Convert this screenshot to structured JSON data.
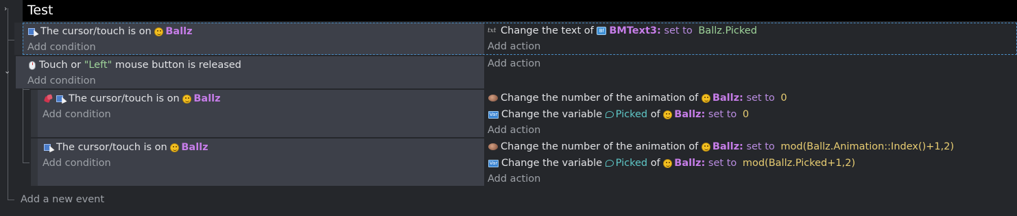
{
  "group": {
    "title": "Test",
    "expand_icon": "chevron-right-icon"
  },
  "events": [
    {
      "conditions": [
        {
          "icons": [
            "cursor-touch-icon"
          ],
          "text": "The cursor/touch is on",
          "object": "Ballz"
        }
      ],
      "add_condition": "Add condition",
      "actions": [
        {
          "icon": "text-icon",
          "text": "Change the text of",
          "object_icon": "bmtext-icon",
          "object": "BMText3",
          "colon": ":",
          "op": "set to",
          "value": "Ballz.Picked"
        }
      ],
      "add_action": "Add action"
    },
    {
      "collapse_icon": "chevron-down-icon",
      "conditions": [
        {
          "icons": [
            "mouse-icon"
          ],
          "prefix": "Touch or",
          "button": "\"Left\"",
          "suffix": "mouse button is released"
        }
      ],
      "add_condition": "Add condition",
      "add_action": "Add action",
      "sub_events": [
        {
          "conditions": [
            {
              "icons": [
                "inverted-condition-icon",
                "cursor-touch-icon"
              ],
              "text": "The cursor/touch is on",
              "object": "Ballz"
            }
          ],
          "add_condition": "Add condition",
          "actions": [
            {
              "icon": "animation-icon",
              "text": "Change the number of the animation of",
              "object": "Ballz",
              "colon": ":",
              "op": "set to",
              "value": "0"
            },
            {
              "icon": "variable-icon",
              "text": "Change the variable",
              "variable": "Picked",
              "of": "of",
              "object": "Ballz",
              "colon": ":",
              "op": "set to",
              "value": "0"
            }
          ],
          "add_action": "Add action"
        },
        {
          "conditions": [
            {
              "icons": [
                "cursor-touch-icon"
              ],
              "text": "The cursor/touch is on",
              "object": "Ballz"
            }
          ],
          "add_condition": "Add condition",
          "actions": [
            {
              "icon": "animation-icon",
              "text": "Change the number of the animation of",
              "object": "Ballz",
              "colon": ":",
              "op": "set to",
              "value": "mod(Ballz.Animation::Index()+1,2)"
            },
            {
              "icon": "variable-icon",
              "text": "Change the variable",
              "variable": "Picked",
              "of": "of",
              "object": "Ballz",
              "colon": ":",
              "op": "set to",
              "value": "mod(Ballz.Picked+1,2)"
            }
          ],
          "add_action": "Add action"
        }
      ]
    }
  ],
  "add_event": "Add a new event",
  "icon_glyphs": {
    "bmtext": "Bf",
    "variable": "Var",
    "text": "txt"
  }
}
